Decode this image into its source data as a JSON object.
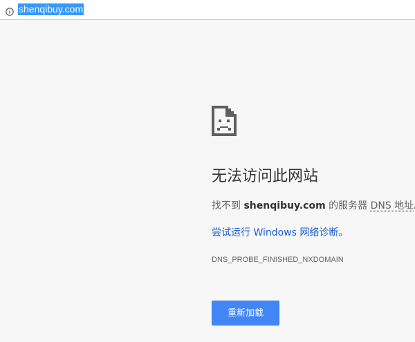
{
  "omnibox": {
    "icon": "info-icon",
    "url": "shenqibuy.com"
  },
  "error": {
    "icon": "sad-page-icon",
    "title": "无法访问此网站",
    "message_prefix": "找不到 ",
    "host": "shenqibuy.com",
    "message_middle": " 的服务器 ",
    "dns_label": "DNS 地址",
    "message_suffix": "。",
    "suggestion": "尝试运行 Windows 网络诊断。",
    "error_code": "DNS_PROBE_FINISHED_NXDOMAIN",
    "reload_label": "重新加载"
  },
  "colors": {
    "page_background": "#f7f7f7",
    "url_highlight": "#3399ff",
    "link": "#1a5ccc",
    "button": "#4285f4"
  }
}
